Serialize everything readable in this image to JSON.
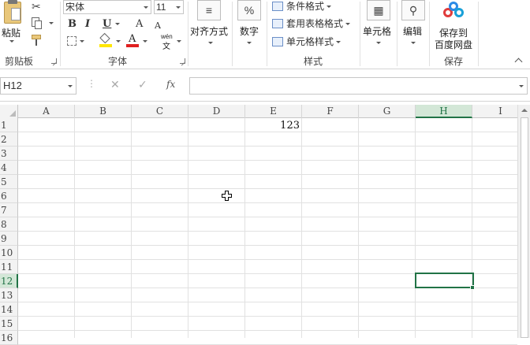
{
  "ribbon": {
    "clipboard": {
      "paste_label": "粘贴",
      "group_label": "剪贴板"
    },
    "font": {
      "font_name": "宋体",
      "font_size": "11",
      "bold": "B",
      "italic": "I",
      "underline": "U",
      "grow": "A",
      "shrink": "A",
      "font_color_glyph": "A",
      "phonetic_top": "wén",
      "phonetic_bottom": "文",
      "group_label": "字体"
    },
    "alignment": {
      "label": "对齐方式"
    },
    "number": {
      "label": "数字",
      "icon": "%"
    },
    "styles": {
      "conditional": "条件格式",
      "table_format": "套用表格格式",
      "cell_styles": "单元格样式",
      "group_label": "样式"
    },
    "cells": {
      "label": "单元格"
    },
    "editing": {
      "label": "编辑"
    },
    "save": {
      "label_line1": "保存到",
      "label_line2": "百度网盘",
      "group_label": "保存"
    }
  },
  "formula_bar": {
    "name_box": "H12",
    "cancel_glyph": "✕",
    "enter_glyph": "✓",
    "fx_glyph": "fx",
    "formula": ""
  },
  "grid": {
    "columns": [
      "A",
      "B",
      "C",
      "D",
      "E",
      "F",
      "G",
      "H",
      "I"
    ],
    "rows": [
      "1",
      "2",
      "3",
      "4",
      "5",
      "6",
      "7",
      "8",
      "9",
      "10",
      "11",
      "12",
      "13",
      "14",
      "15",
      "16"
    ],
    "cells": {
      "E1": "123"
    },
    "selected_cell": "H12"
  },
  "colors": {
    "accent_green": "#217346",
    "selected_header_bg": "#d3e7d7",
    "gridline": "#e1e1e1"
  }
}
